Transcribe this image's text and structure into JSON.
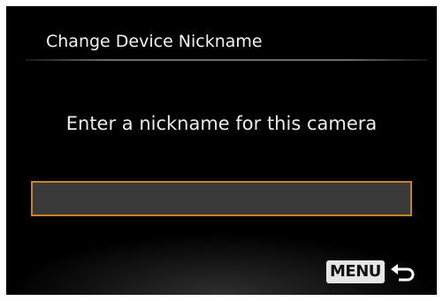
{
  "screen": {
    "title": "Change Device Nickname",
    "prompt": "Enter a nickname for this camera",
    "nickname_field": {
      "value": "",
      "placeholder": ""
    },
    "footer": {
      "menu_label": "MENU",
      "back_icon": "return-arrow-icon"
    }
  },
  "colors": {
    "background": "#000000",
    "text": "#f2f2f2",
    "field_border": "#c6842a",
    "field_fill": "#3a3a3a"
  }
}
